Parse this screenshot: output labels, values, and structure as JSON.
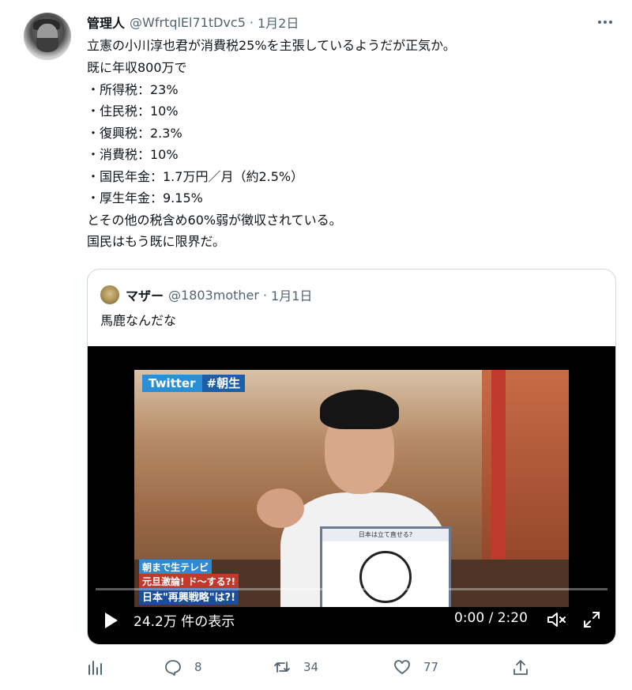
{
  "tweet": {
    "author_name": "管理人",
    "handle": "@WfrtqlEl71tDvc5",
    "date": "1月2日",
    "lines": [
      "立憲の小川淳也君が消費税25%を主張しているようだが正気か。",
      "既に年収800万で",
      "・所得税：23%",
      "・住民税：10%",
      "・復興税：2.3%",
      "・消費税：10%",
      "・国民年金：1.7万円／月（約2.5%）",
      "・厚生年金：9.15%",
      "とその他の税含め60%弱が徴収されている。",
      "国民はもう既に限界だ。"
    ]
  },
  "quote": {
    "author_name": "マザー",
    "handle": "@1803mother",
    "date": "1月1日",
    "text": "馬鹿なんだな",
    "video": {
      "tag_twitter": "Twitter",
      "tag_hashtag": "#朝生",
      "board_title": "日本は立て直せる?",
      "caption_1": "朝まで生テレビ",
      "caption_2": "元旦激論! ド〜する?!",
      "caption_3": "日本\"再興戦略\"は?!",
      "views": "24.2万 件の表示",
      "time": "0:00 / 2:20",
      "progress": 0.0
    }
  },
  "actions": {
    "replies": "8",
    "retweets": "34",
    "likes": "77"
  },
  "icons": {
    "more": "more-horizontal-icon",
    "analytics": "analytics-icon",
    "reply": "reply-icon",
    "retweet": "retweet-icon",
    "like": "heart-icon",
    "share": "share-icon",
    "play": "play-icon",
    "mute": "mute-icon",
    "fullscreen": "fullscreen-icon"
  }
}
